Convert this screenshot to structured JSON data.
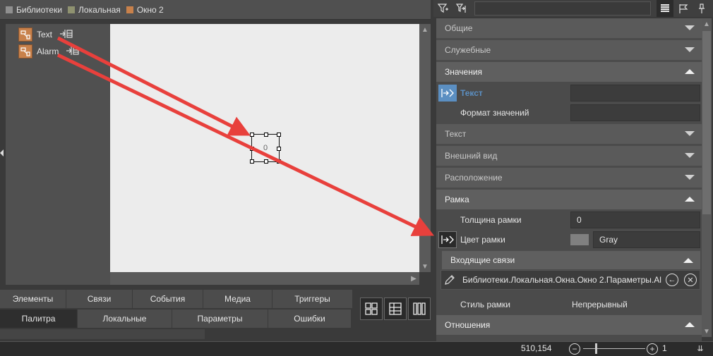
{
  "breadcrumb": [
    {
      "label": "Библиотеки",
      "color": "#8f8f8f"
    },
    {
      "label": "Локальная",
      "color": "#8f9270"
    },
    {
      "label": "Окно 2",
      "color": "#c8814b"
    }
  ],
  "tree": [
    {
      "label": "Text"
    },
    {
      "label": "Alarm"
    }
  ],
  "canvas": {
    "widget_value": "0"
  },
  "bottom_tabs_row1": [
    "Элементы",
    "Связи",
    "События",
    "Медиа",
    "Триггеры"
  ],
  "bottom_tabs_row2": [
    "Палитра",
    "Локальные",
    "Параметры",
    "Ошибки"
  ],
  "status": {
    "coords": "510,154",
    "zoom": "1"
  },
  "props": {
    "sections": {
      "general": "Общие",
      "service": "Служебные",
      "values": "Значения",
      "text": "Текст",
      "appearance": "Внешний вид",
      "position": "Расположение",
      "frame": "Рамка",
      "incoming": "Входящие связи",
      "relations": "Отношения"
    },
    "values_text_label": "Текст",
    "values_text_value": "",
    "value_format_label": "Формат значений",
    "value_format_value": "",
    "frame_width_label": "Толщина рамки",
    "frame_width_value": "0",
    "frame_color_label": "Цвет рамки",
    "frame_color_value": "Gray",
    "frame_color_swatch": "#808080",
    "incoming_link_path": "Библиотеки.Локальная.Окна.Окно 2.Параметры.Al",
    "frame_style_label": "Стиль рамки",
    "frame_style_value": "Непрерывный"
  },
  "colors": {
    "accent": "#5b8fc2",
    "annotation_arrow": "#e8403c"
  }
}
